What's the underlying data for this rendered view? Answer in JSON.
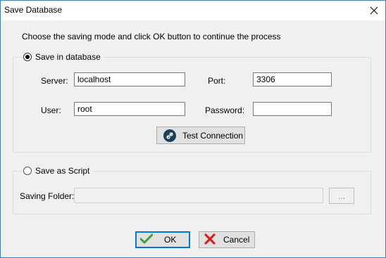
{
  "window": {
    "title": "Save Database"
  },
  "instruction": "Choose the saving mode and click OK button to continue the process",
  "db_group": {
    "legend": "Save in database",
    "selected": true,
    "server_label": "Server:",
    "server_value": "localhost",
    "port_label": "Port:",
    "port_value": "3306",
    "user_label": "User:",
    "user_value": "root",
    "password_label": "Password:",
    "password_value": "",
    "test_button": "Test Connection"
  },
  "script_group": {
    "legend": "Save as Script",
    "selected": false,
    "folder_label": "Saving Folder:",
    "folder_value": "",
    "browse_label": "..."
  },
  "buttons": {
    "ok": "OK",
    "cancel": "Cancel"
  },
  "icons": {
    "close": "close-icon",
    "test": "link-icon",
    "ok": "checkmark-icon",
    "cancel": "x-icon"
  },
  "colors": {
    "window_border": "#3c7fb1",
    "focus": "#0078d7",
    "ok_green": "#3ba03b",
    "cancel_red": "#d62020"
  }
}
